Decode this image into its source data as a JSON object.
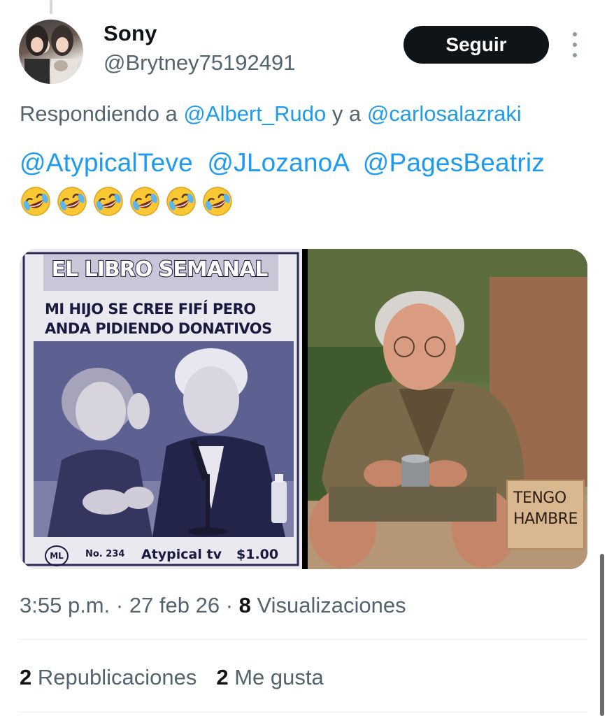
{
  "author": {
    "display_name": "Sony",
    "handle": "@Brytney75192491"
  },
  "header": {
    "follow_label": "Seguir"
  },
  "reply": {
    "prefix": "Respondiendo a ",
    "mention_1": "@Albert_Rudo",
    "joiner": " y a ",
    "mention_2": "@carlosalazraki"
  },
  "tweet": {
    "mentions": [
      "@AtypicalTeve",
      "@JLozanoA",
      "@PagesBeatriz"
    ],
    "emoji_count": 6,
    "emoji_icon": "rolling-on-the-floor-laughing-icon"
  },
  "media": {
    "left": {
      "title": "EL LIBRO SEMANAL",
      "subtitle_line_1": "MI HIJO SE CREE FIFÍ PERO",
      "subtitle_line_2": "ANDA PIDIENDO DONATIVOS",
      "logo": "ML",
      "issue": "No. 234",
      "brand": "Atypical tv",
      "price": "$1.00"
    },
    "right": {
      "sign_line_1": "TENGO",
      "sign_line_2": "HAMBRE"
    }
  },
  "meta": {
    "time": "3:55 p.m.",
    "sep_1": " · ",
    "date": "27 feb 26",
    "sep_2": " · ",
    "views_count": "8",
    "views_label": " Visualizaciones"
  },
  "stats": {
    "reposts_count": "2",
    "reposts_label": " Republicaciones",
    "likes_count": "2",
    "likes_label": " Me gusta"
  },
  "colors": {
    "link": "#1d9bf0",
    "secondary_text": "#536471",
    "primary_text": "#0f1419",
    "button_bg": "#0f1419"
  }
}
